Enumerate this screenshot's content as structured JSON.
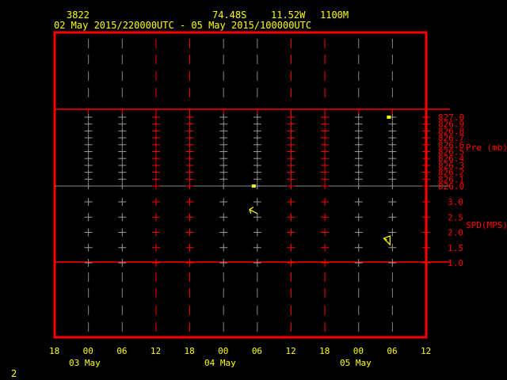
{
  "header": {
    "station_id": "3822",
    "latitude": "74.48S",
    "longitude": "11.52W",
    "elevation": "1100M",
    "time_range": "02 May 2015/220000UTC - 05 May 2015/100000UTC"
  },
  "footer": {
    "page_number": "2"
  },
  "colors": {
    "frame": "#ff0000",
    "text": "#ffff00",
    "data": "#ffff00",
    "gridline": "#ff0000"
  },
  "chart_data": {
    "type": "scatter",
    "x_ticks": [
      "18",
      "00",
      "06",
      "12",
      "18",
      "00",
      "06",
      "12",
      "18",
      "00",
      "06",
      "12"
    ],
    "day_labels": [
      "03 May",
      "04 May",
      "05 May"
    ],
    "panels": [
      {
        "name": "pressure",
        "ylabel": "Pre (mb)",
        "ylim": [
          826.0,
          827.0
        ],
        "ticks": [
          "827.0",
          "826.9",
          "826.8",
          "826.7",
          "826.6",
          "826.5",
          "826.4",
          "826.3",
          "826.2",
          "826.1",
          "826.0"
        ],
        "points": [
          {
            "x": "04 May 06",
            "y": 826.0
          },
          {
            "x": "05 May 06",
            "y": 827.0
          }
        ]
      },
      {
        "name": "wind speed",
        "ylabel": "SPD(MPS)",
        "ylim": [
          1.0,
          3.0
        ],
        "ticks": [
          "3.0",
          "2.5",
          "2.0",
          "1.5",
          "1.0"
        ],
        "points": [
          {
            "x": "04 May 06",
            "y": 2.8,
            "direction": "from east-southeast"
          },
          {
            "x": "05 May 06",
            "y": 1.7,
            "direction": "from north-northwest"
          }
        ]
      }
    ]
  }
}
